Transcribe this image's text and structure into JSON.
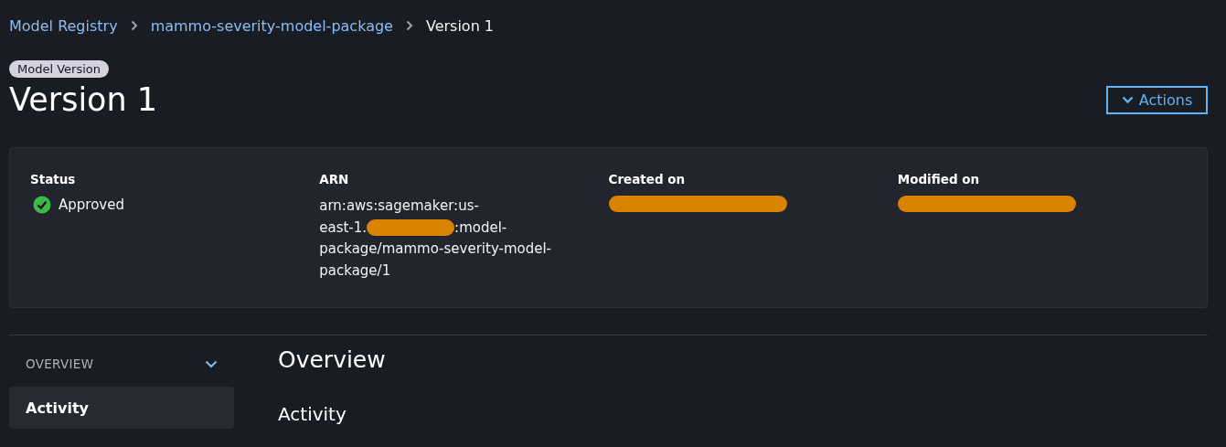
{
  "breadcrumb": [
    {
      "label": "Model Registry",
      "kind": "link"
    },
    {
      "label": "mammo-severity-model-package",
      "kind": "link"
    },
    {
      "label": "Version 1",
      "kind": "current"
    }
  ],
  "badge": "Model Version",
  "title": "Version 1",
  "actions_button": {
    "label": "Actions"
  },
  "summary": [
    {
      "label": "Status",
      "kind": "status",
      "value": "Approved"
    },
    {
      "label": "ARN",
      "kind": "arn",
      "lines": [
        [
          {
            "kind": "text",
            "text": "arn:aws:sagemaker:us-"
          }
        ],
        [
          {
            "kind": "text",
            "text": "east-1."
          },
          {
            "kind": "redaction"
          },
          {
            "kind": "text",
            "text": ":model-"
          }
        ],
        [
          {
            "kind": "text",
            "text": "package/mammo-severity-model-"
          }
        ],
        [
          {
            "kind": "text",
            "text": "package/1"
          }
        ]
      ]
    },
    {
      "label": "Created on",
      "kind": "redacted"
    },
    {
      "label": "Modified on",
      "kind": "redacted"
    }
  ],
  "sidebar": {
    "section": "OVERVIEW",
    "expanded": true,
    "items": [
      {
        "label": "Activity",
        "selected": true
      }
    ]
  },
  "content": {
    "heading": "Overview",
    "subheading": "Activity"
  }
}
